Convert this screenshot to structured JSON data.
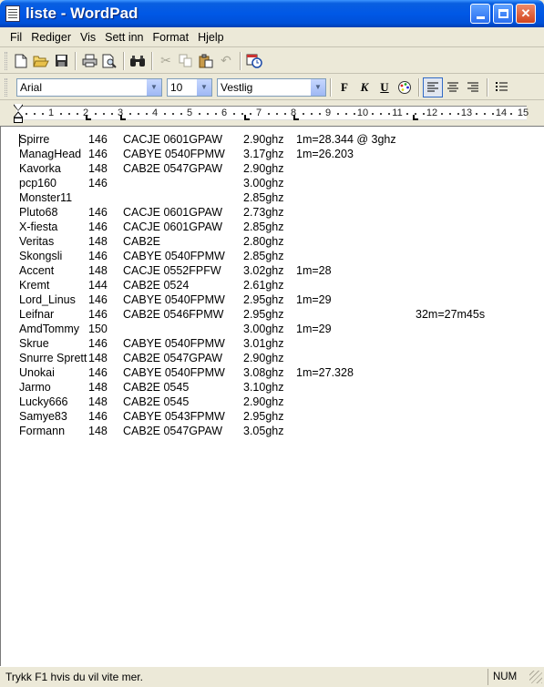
{
  "window": {
    "title": "liste - WordPad"
  },
  "menu": [
    "Fil",
    "Rediger",
    "Vis",
    "Sett inn",
    "Format",
    "Hjelp"
  ],
  "toolbar": {
    "icons": [
      "new-icon",
      "open-icon",
      "save-icon",
      "print-icon",
      "print-preview-icon",
      "find-icon",
      "cut-icon",
      "copy-icon",
      "paste-icon",
      "undo-icon",
      "insert-date-icon"
    ]
  },
  "format": {
    "font": "Arial",
    "size": "10",
    "script": "Vestlig",
    "bold": "F",
    "italic": "K",
    "underline": "U"
  },
  "ruler": {
    "numbers": [
      "1",
      "2",
      "3",
      "4",
      "5",
      "6",
      "7",
      "8",
      "9",
      "10",
      "11",
      "12",
      "13",
      "14",
      "15"
    ]
  },
  "document": {
    "rows": [
      [
        "Spirre",
        "146",
        "CACJE 0601GPAW",
        "2.90ghz",
        "1m=28.344 @ 3ghz",
        ""
      ],
      [
        "ManagHead",
        "146",
        "CABYE 0540FPMW",
        "3.17ghz",
        "1m=26.203",
        ""
      ],
      [
        "Kavorka",
        "148",
        "CAB2E 0547GPAW",
        "2.90ghz",
        "",
        ""
      ],
      [
        "pcp160",
        "146",
        "",
        "3.00ghz",
        "",
        ""
      ],
      [
        "Monster11",
        "",
        "",
        "2.85ghz",
        "",
        ""
      ],
      [
        "Pluto68",
        "146",
        "CACJE 0601GPAW",
        "2.73ghz",
        "",
        ""
      ],
      [
        "X-fiesta",
        "146",
        "CACJE 0601GPAW",
        "2.85ghz",
        "",
        ""
      ],
      [
        "Veritas",
        "148",
        "CAB2E",
        "2.80ghz",
        "",
        ""
      ],
      [
        "Skongsli",
        "146",
        "CABYE 0540FPMW",
        "2.85ghz",
        "",
        ""
      ],
      [
        "Accent",
        "148",
        "CACJE 0552FPFW",
        "3.02ghz",
        "1m=28",
        ""
      ],
      [
        "Kremt",
        "144",
        "CAB2E 0524",
        "2.61ghz",
        "",
        ""
      ],
      [
        "Lord_Linus",
        "146",
        "CABYE 0540FPMW",
        "2.95ghz",
        "1m=29",
        ""
      ],
      [
        "Leifnar",
        "146",
        "CAB2E 0546FPMW",
        "2.95ghz",
        "",
        "32m=27m45s"
      ],
      [
        "AmdTommy",
        "150",
        "",
        "3.00ghz",
        "1m=29",
        ""
      ],
      [
        "Skrue",
        "146",
        "CABYE 0540FPMW",
        "3.01ghz",
        "",
        ""
      ],
      [
        "Snurre Sprett",
        "148",
        "CAB2E 0547GPAW",
        "2.90ghz",
        "",
        ""
      ],
      [
        "Unokai",
        "146",
        "CABYE 0540FPMW",
        "3.08ghz",
        "1m=27.328",
        ""
      ],
      [
        "Jarmo",
        "148",
        "CAB2E 0545",
        "3.10ghz",
        "",
        ""
      ],
      [
        "Lucky666",
        "148",
        "CAB2E 0545",
        "2.90ghz",
        "",
        ""
      ],
      [
        "Samye83",
        "146",
        "CABYE 0543FPMW",
        "2.95ghz",
        "",
        ""
      ],
      [
        "Formann",
        "148",
        "CAB2E 0547GPAW",
        "3.05ghz",
        "",
        ""
      ]
    ]
  },
  "status": {
    "help": "Trykk F1 hvis du vil vite mer.",
    "num": "NUM"
  }
}
